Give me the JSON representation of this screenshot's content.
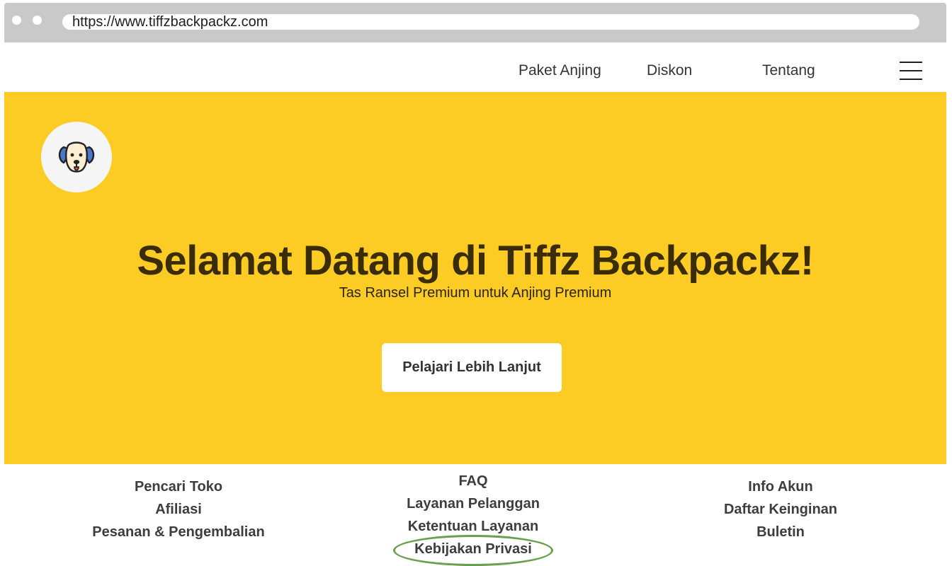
{
  "browser": {
    "url": "https://www.tiffzbackpackz.com"
  },
  "nav": {
    "links": [
      {
        "label": "Paket Anjing"
      },
      {
        "label": "Diskon"
      },
      {
        "label": "Tentang"
      }
    ],
    "menu_icon": "hamburger-menu-icon"
  },
  "hero": {
    "logo_icon": "dog-face-icon",
    "title": "Selamat Datang di Tiffz Backpackz!",
    "subtitle": "Tas Ransel Premium untuk Anjing Premium",
    "cta_label": "Pelajari Lebih Lanjut",
    "background_color": "#fccb24"
  },
  "footer": {
    "col1": [
      "Pencari Toko",
      "Afiliasi",
      "Pesanan & Pengembalian"
    ],
    "col2": [
      "FAQ",
      "Layanan Pelanggan",
      "Ketentuan Layanan",
      "Kebijakan Privasi"
    ],
    "col3": [
      "Info Akun",
      "Daftar Keinginan",
      "Buletin"
    ],
    "highlight_color": "#6a9f4e"
  }
}
